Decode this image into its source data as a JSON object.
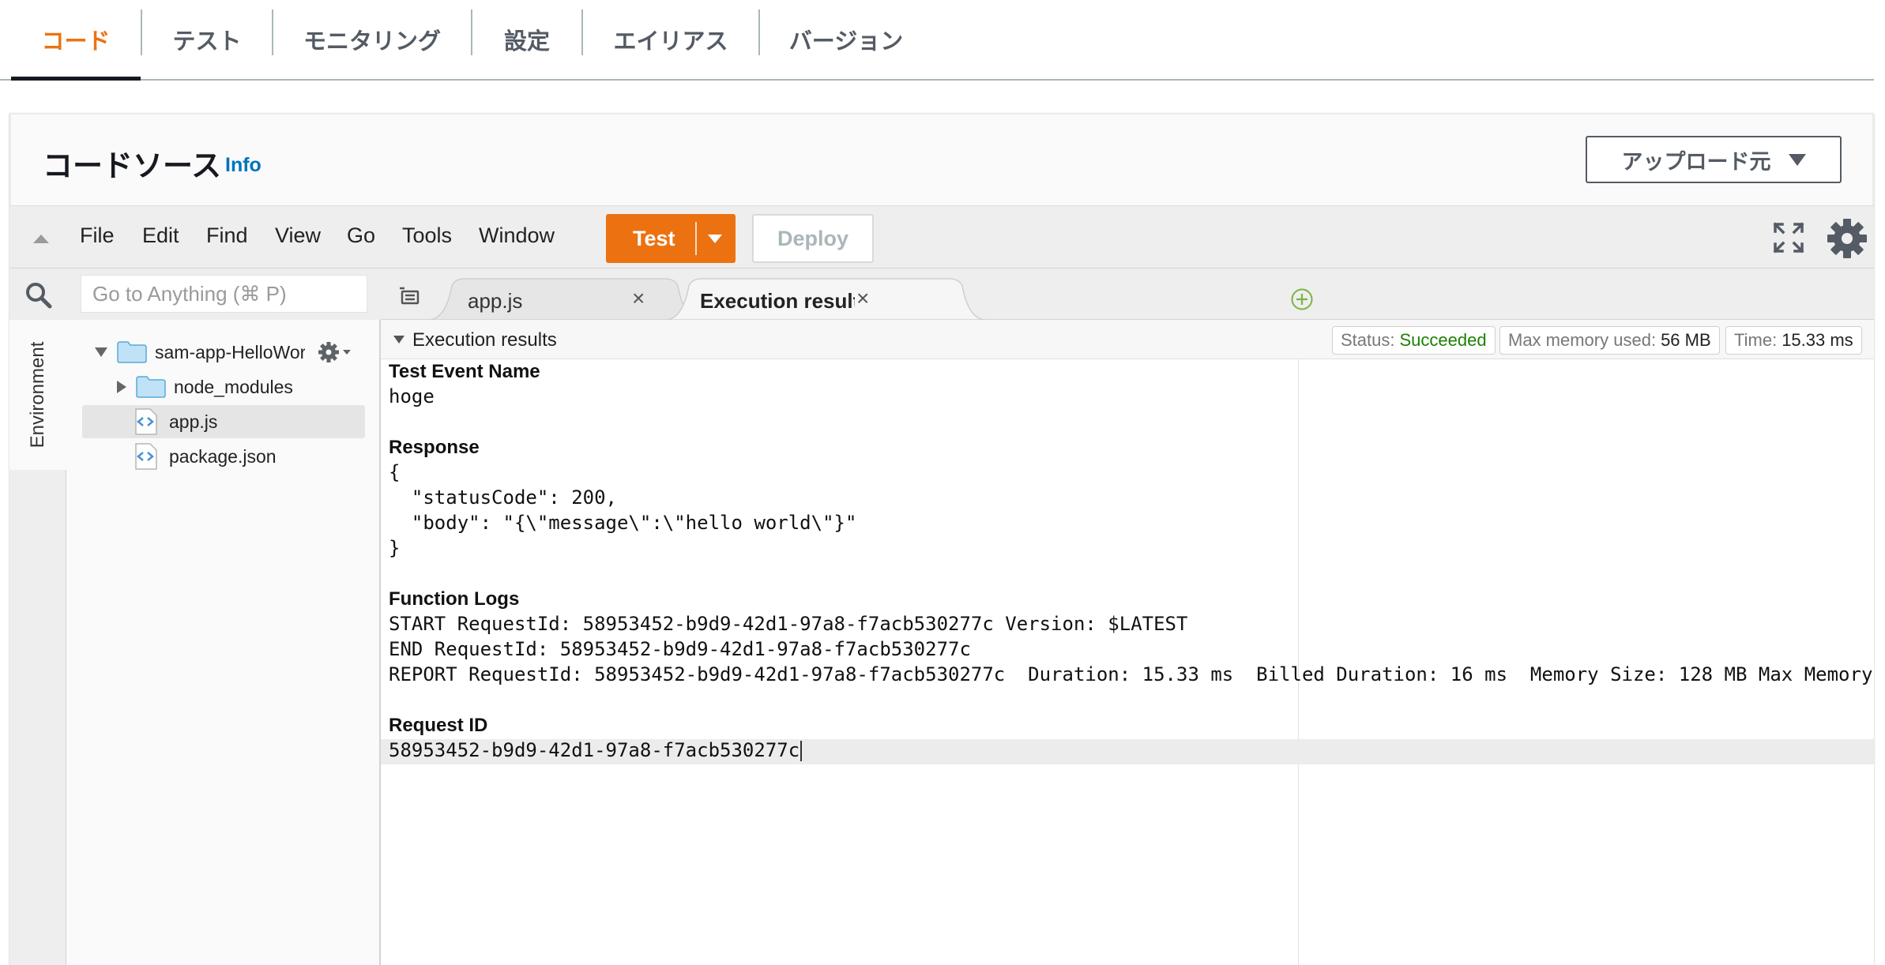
{
  "top_tabs": [
    "コード",
    "テスト",
    "モニタリング",
    "設定",
    "エイリアス",
    "バージョン"
  ],
  "panel": {
    "title": "コードソース",
    "info": "Info",
    "upload_label": "アップロード元"
  },
  "menu": [
    "File",
    "Edit",
    "Find",
    "View",
    "Go",
    "Tools",
    "Window"
  ],
  "buttons": {
    "test": "Test",
    "deploy": "Deploy"
  },
  "search": {
    "placeholder": "Go to Anything (⌘ P)"
  },
  "sidebar": {
    "environment_tab": "Environment"
  },
  "tree": {
    "root": "sam-app-HelloWorlc",
    "items": [
      "node_modules",
      "app.js",
      "package.json"
    ],
    "selected": "app.js"
  },
  "editor_tabs": [
    "app.js",
    "Execution results"
  ],
  "results": {
    "header": "Execution results",
    "status_label": "Status:",
    "status_value": "Succeeded",
    "memory_label": "Max memory used:",
    "memory_value": "56 MB",
    "time_label": "Time:",
    "time_value": "15.33 ms",
    "test_event_title": "Test Event Name",
    "test_event_value": "hoge",
    "response_title": "Response",
    "response_lines": [
      "{",
      "  \"statusCode\": 200,",
      "  \"body\": \"{\\\"message\\\":\\\"hello world\\\"}\"",
      "}"
    ],
    "logs_title": "Function Logs",
    "log_lines": [
      "START RequestId: 58953452-b9d9-42d1-97a8-f7acb530277c Version: $LATEST",
      "END RequestId: 58953452-b9d9-42d1-97a8-f7acb530277c",
      "REPORT RequestId: 58953452-b9d9-42d1-97a8-f7acb530277c  Duration: 15.33 ms  Billed Duration: 16 ms  Memory Size: 128 MB Max Memory"
    ],
    "request_id_title": "Request ID",
    "request_id_value": "58953452-b9d9-42d1-97a8-f7acb530277c"
  },
  "colors": {
    "accent": "#ec7211",
    "link": "#0073bb",
    "success": "#1d8102"
  }
}
